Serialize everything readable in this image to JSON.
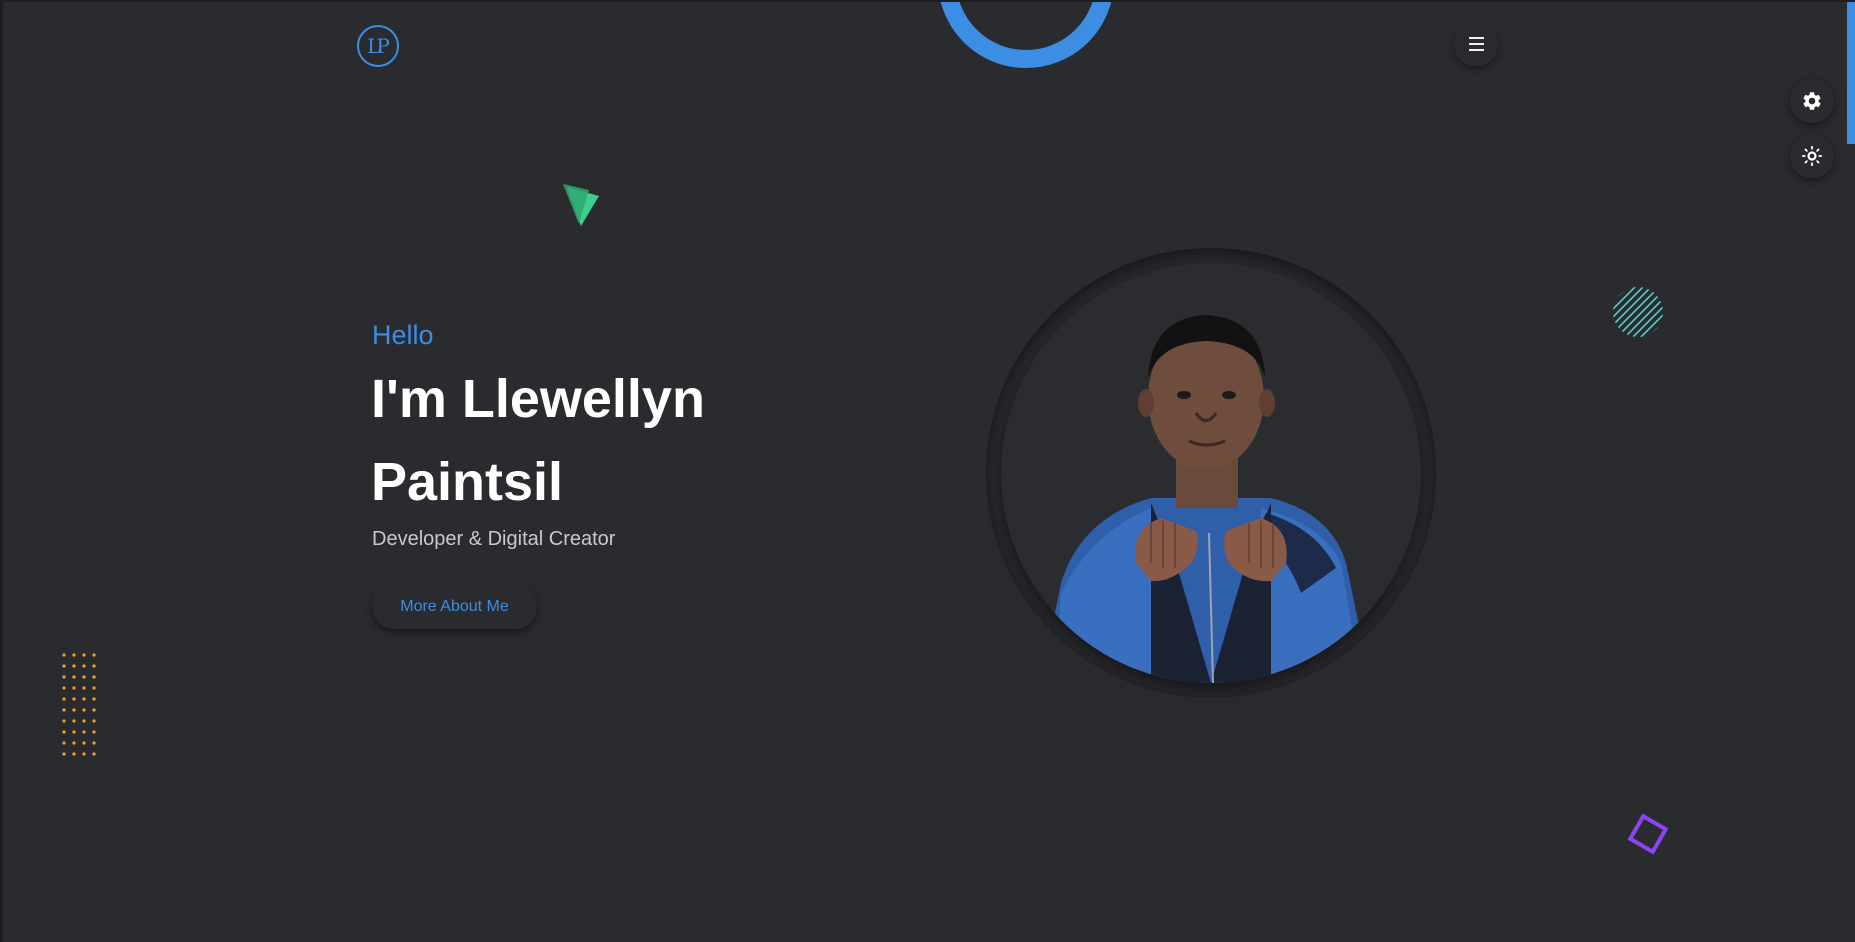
{
  "header": {
    "logo_text": "LP",
    "menu_icon": "hamburger-menu-icon"
  },
  "side_controls": {
    "settings_icon": "gear-icon",
    "theme_icon": "sun-icon"
  },
  "hero": {
    "greeting": "Hello",
    "name": "I'm Llewellyn Paintsil",
    "tagline": "Developer & Digital Creator",
    "cta_label": "More About Me",
    "portrait_alt": "Portrait"
  },
  "colors": {
    "background": "#2a2b2f",
    "accent": "#3b8ee3",
    "green_shape": "#3ecf8e",
    "teal_lines": "#5ec8c4",
    "orange_dots": "#f2a02a",
    "purple_square": "#8d44f0"
  }
}
